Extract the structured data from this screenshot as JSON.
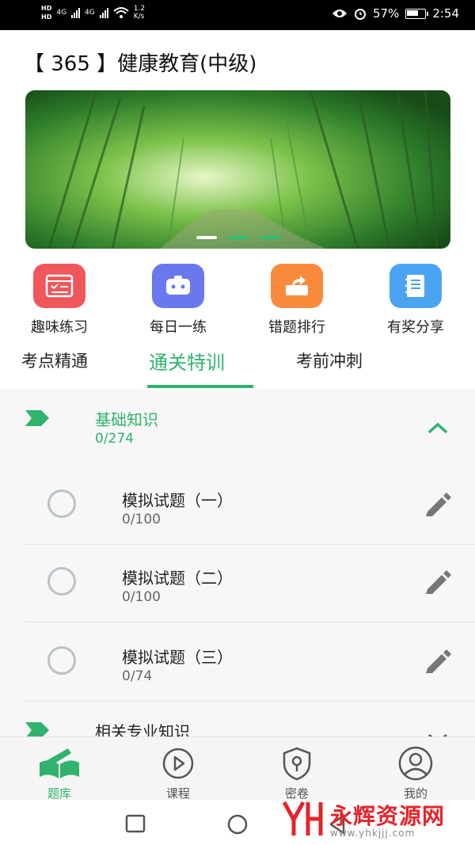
{
  "status_bar": {
    "hd1": "HD",
    "hd2": "HD",
    "net1": "4G",
    "net2": "4G",
    "speed_value": "1.2",
    "speed_unit": "K/s",
    "battery_percent": "57%",
    "time": "2:54"
  },
  "header": {
    "title": "【 365 】健康教育(中级)"
  },
  "banner": {
    "slides": 3,
    "active_slide": 1
  },
  "quick_actions": [
    {
      "label": "趣味练习",
      "icon": "practice-icon",
      "color": "#f0575b"
    },
    {
      "label": "每日一练",
      "icon": "robot-icon",
      "color": "#6a78ee"
    },
    {
      "label": "错题排行",
      "icon": "share-box-icon",
      "color": "#f98a3c"
    },
    {
      "label": "有奖分享",
      "icon": "notebook-icon",
      "color": "#4aa4f2"
    }
  ],
  "tabs": [
    {
      "label": "考点精通",
      "active": false
    },
    {
      "label": "通关特训",
      "active": true
    },
    {
      "label": "考前冲刺",
      "active": false
    }
  ],
  "sections": [
    {
      "title": "基础知识",
      "count": "0/274",
      "expanded": true,
      "items": [
        {
          "name": "模拟试题（一）",
          "count": "0/100"
        },
        {
          "name": "模拟试题（二）",
          "count": "0/100"
        },
        {
          "name": "模拟试题（三）",
          "count": "0/74"
        }
      ]
    },
    {
      "title": "相关专业知识",
      "expanded": false
    }
  ],
  "bottom_nav": [
    {
      "label": "题库",
      "icon": "book-pen-icon",
      "active": true
    },
    {
      "label": "课程",
      "icon": "play-icon",
      "active": false
    },
    {
      "label": "密卷",
      "icon": "shield-lock-icon",
      "active": false
    },
    {
      "label": "我的",
      "icon": "user-icon",
      "active": false
    }
  ],
  "watermark": {
    "brand": "永辉资源网",
    "url": "www.yhkjjj.com"
  },
  "colors": {
    "accent": "#2fb36d",
    "list_bg": "#f7f7f7"
  }
}
